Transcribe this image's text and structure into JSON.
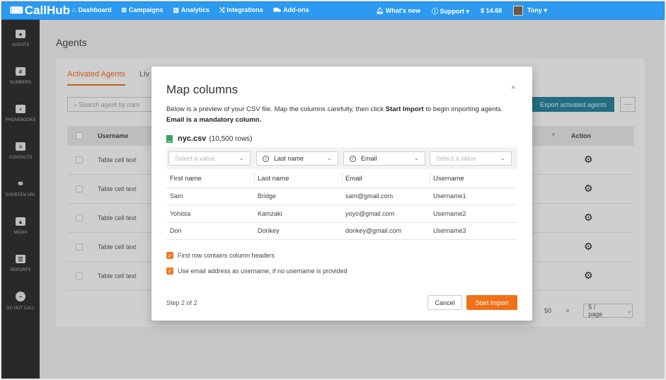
{
  "topbar": {
    "brand": "CallHub",
    "nav": [
      {
        "icon": "🏠",
        "label": "Dashboard"
      },
      {
        "icon": "⊞",
        "label": "Campaigns"
      },
      {
        "icon": "📊",
        "label": "Analytics"
      },
      {
        "icon": "⤭",
        "label": "Integrations"
      },
      {
        "icon": "🛒",
        "label": "Add-ons"
      }
    ],
    "whats_new": "What's new",
    "support": "Support",
    "balance": "$ 14.68",
    "user": "Tony"
  },
  "sidebar": {
    "items": [
      {
        "label": "AGENTS",
        "icon": "user-icon"
      },
      {
        "label": "NUMBERS",
        "icon": "numbers-icon"
      },
      {
        "label": "PHONEBOOKS",
        "icon": "phonebook-icon"
      },
      {
        "label": "CONTACTS",
        "icon": "contacts-icon"
      },
      {
        "label": "SHORTEN URL",
        "icon": "link-icon"
      },
      {
        "label": "MEDIA",
        "icon": "media-icon"
      },
      {
        "label": "REPORTS",
        "icon": "reports-icon"
      },
      {
        "label": "DO NOT CALL",
        "icon": "block-icon"
      }
    ]
  },
  "page": {
    "title": "Agents",
    "tab_active": "Activated Agents",
    "tab_other": "Liv",
    "search_placeholder": "Search agent by nam",
    "export_label": "Export activated agents",
    "more_label": "···",
    "col_username": "Username",
    "col_action": "Action",
    "rows": [
      "Table cell text",
      "Table cell text",
      "Table cell text",
      "Table cell text",
      "Table cell text"
    ],
    "pager_page": "50",
    "pager_next": ">",
    "page_size": "5 / page"
  },
  "modal": {
    "title": "Map columns",
    "close": "×",
    "desc_1": "Below is a preview of your CSV file. Map the columns carefully, then click ",
    "desc_bold_1": "Start Import",
    "desc_2": " to begin importing agents. ",
    "desc_bold_2": "Email is a mandatory column.",
    "file_name": "nyc.csv",
    "file_rows": "(10,500 rows)",
    "selects": [
      {
        "value": "Select a value",
        "placeholder": true
      },
      {
        "value": "Last name",
        "placeholder": false
      },
      {
        "value": "Email",
        "placeholder": false
      },
      {
        "value": "Select a value",
        "placeholder": true
      }
    ],
    "headers": [
      "First name",
      "Last name",
      "Email",
      "Username"
    ],
    "rows": [
      [
        "Sam",
        "Bridge",
        "sam@gmail.com",
        "Username1"
      ],
      [
        "Yohista",
        "Kamzaki",
        "yoyo@gmail.com",
        "Username2"
      ],
      [
        "Don",
        "Donkey",
        "donkey@gmail.com",
        "Username3"
      ]
    ],
    "option_1": "First row contains column headers",
    "option_2": "Use email address as username, if no username is provided",
    "step": "Step 2 of 2",
    "cancel": "Cancel",
    "start": "Start Import"
  }
}
